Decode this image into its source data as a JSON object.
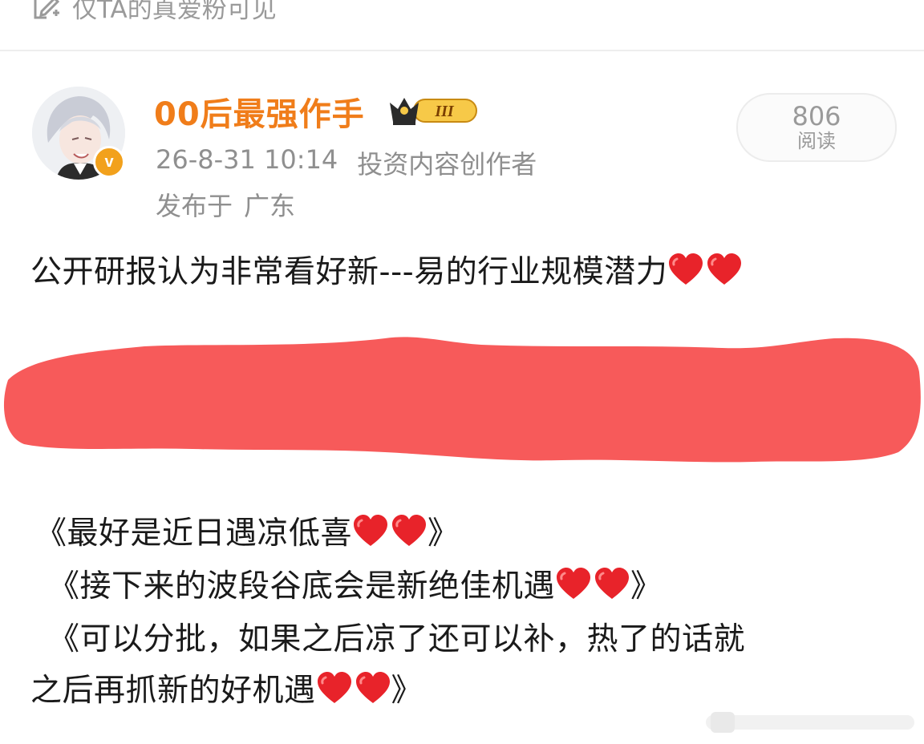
{
  "visibility": {
    "text": "仅TA的真爱粉可见",
    "icon": "pen-lock-icon"
  },
  "author": {
    "name": "00后最强作手",
    "verified_icon": "v-verified-icon",
    "level_badge_text": "III",
    "level_badge_icon": "crown-level-badge-icon"
  },
  "meta": {
    "timestamp": "26-8-31 10:14",
    "role": "投资内容创作者",
    "location_prefix": "发布于",
    "location": "广东"
  },
  "reads": {
    "count": "806",
    "label": "阅读"
  },
  "post": {
    "line1": "公开研报认为非常看好新---易的行业规模潜力",
    "quote1": "《最好是近日遇凉低喜",
    "quote1_end": "》",
    "quote2": "《接下来的波段谷底会是新绝佳机遇",
    "quote2_end": "》",
    "quote3_line1": "《可以分批，如果之后凉了还可以补，热了的话就",
    "quote3_line2": "之后再抓新的好机遇",
    "quote3_end": "》",
    "heart_emoji": "red-heart-icon"
  },
  "colors": {
    "author_name": "#f07d1a",
    "meta_text": "#8f8f8f",
    "body_text": "#1a1a1a",
    "redaction": "#f75a5a",
    "heart": "#e8232a",
    "verified_badge": "#f2a11c"
  }
}
